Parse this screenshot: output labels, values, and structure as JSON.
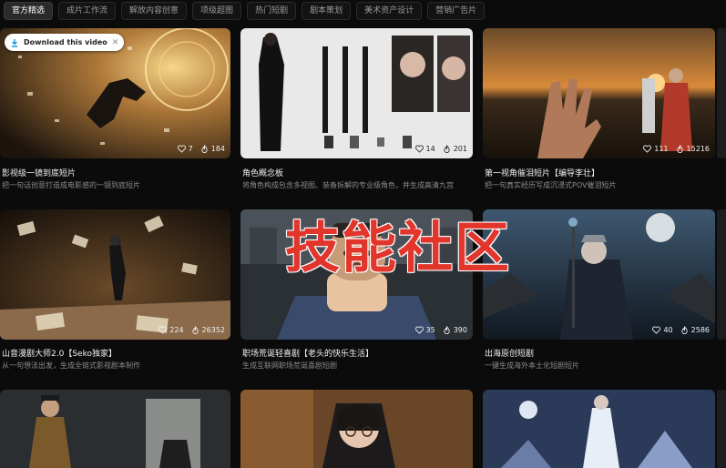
{
  "tabs": [
    "官方精选",
    "成片工作流",
    "解放内容创意",
    "项级超图",
    "热门短剧",
    "剧本策划",
    "美术资产设计",
    "营销广告片"
  ],
  "download_pill": {
    "label": "Download this video",
    "close": "✕"
  },
  "cards": [
    {
      "title": "影视级一镜到底短片",
      "desc": "把一句话创意打造成电影感的一镜到底短片",
      "likes": "7",
      "views": "184"
    },
    {
      "title": "角色概念板",
      "desc": "将角色构成包含多视图、装备拆解的专业级角色，并生成高清九宫",
      "likes": "14",
      "views": "201"
    },
    {
      "title": "第一视角催泪短片【编导李壮】",
      "desc": "把一句真实经历写成沉浸式POV催泪短片",
      "likes": "111",
      "views": "15216"
    },
    {
      "title": "山音漫剧大师2.0【Seko独家】",
      "desc": "从一句想法出发，生成全链式影视剧本制作",
      "likes": "224",
      "views": "26352"
    },
    {
      "title": "职场荒诞轻喜剧【老头的快乐生活】",
      "desc": "生成互联网职场荒诞喜剧短剧",
      "likes": "35",
      "views": "390"
    },
    {
      "title": "出海原创短剧",
      "desc": "一键生成海外本土化短剧短片",
      "likes": "40",
      "views": "2586"
    }
  ],
  "overlay_text": "技能社区"
}
